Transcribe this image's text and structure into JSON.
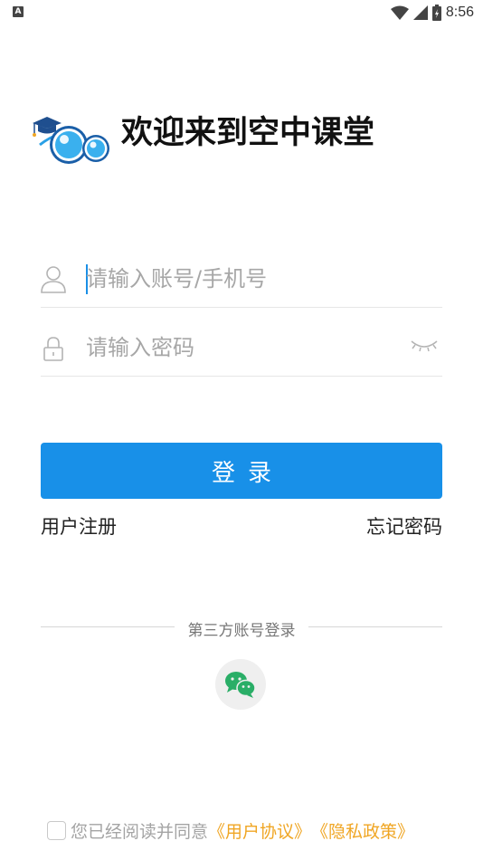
{
  "status_bar": {
    "app_badge": "A",
    "time": "8:56"
  },
  "header": {
    "welcome_text": "欢迎来到空中课堂"
  },
  "form": {
    "account": {
      "placeholder": "请输入账号/手机号",
      "value": ""
    },
    "password": {
      "placeholder": "请输入密码",
      "value": ""
    }
  },
  "login_button": {
    "label": "登录"
  },
  "links": {
    "register": "用户注册",
    "forgot_password": "忘记密码"
  },
  "third_party": {
    "title": "第三方账号登录",
    "providers": [
      {
        "name": "wechat-icon"
      }
    ]
  },
  "agreement": {
    "prefix": "您已经阅读并同意",
    "user_agreement": "《用户协议》",
    "privacy_policy": "《隐私政策》",
    "checked": false
  },
  "colors": {
    "primary": "#1890e8",
    "link_accent": "#f0a624",
    "wechat": "#2aae67"
  }
}
